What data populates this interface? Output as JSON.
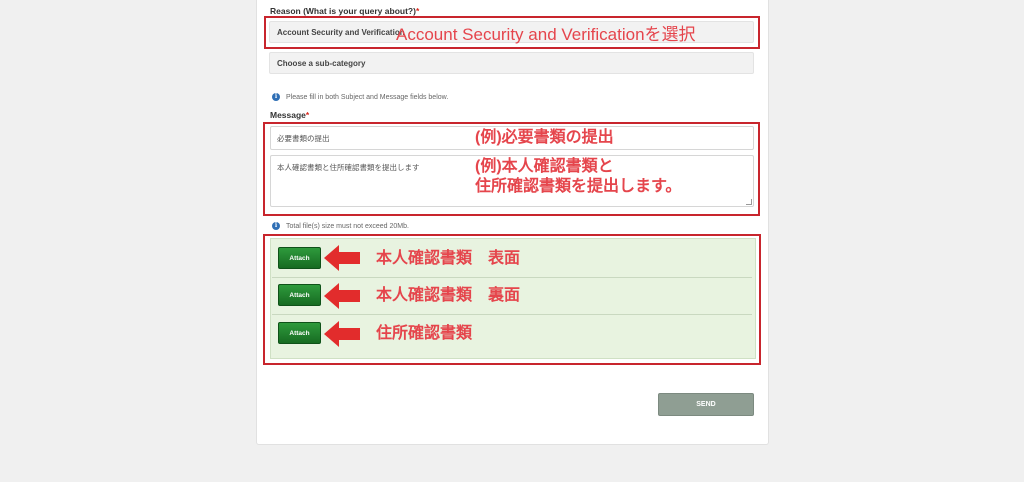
{
  "form": {
    "reason_label": "Reason (What is your query about?)",
    "required_mark": "*",
    "reason_value": "Account Security and Verification",
    "subcategory_placeholder": "Choose a sub-category",
    "info_hint": "Please fill in both Subject and Message fields below.",
    "message_label": "Message",
    "subject_value": "必要書類の提出",
    "message_value": "本人確認書類と住所確認書類を提出します",
    "file_hint": "Total file(s) size must not exceed 20Mb.",
    "attach_buttons": [
      "Attach",
      "Attach",
      "Attach"
    ],
    "send_label": "SEND"
  },
  "annotations": {
    "reason": "Account Security and Verificationを選択",
    "subject": "(例)必要書類の提出",
    "message_line1": "(例)本人確認書類と",
    "message_line2": "住所確認書類を提出します。",
    "attach_1": "本人確認書類　表面",
    "attach_2": "本人確認書類　裏面",
    "attach_3": "住所確認書類"
  },
  "icons": {
    "info": "info-icon",
    "arrow": "left-arrow-icon"
  },
  "colors": {
    "annotation_red": "#e5454c",
    "box_red": "#c8252d",
    "attach_green": "#1e7f2c",
    "send_gray": "#8f9e93"
  }
}
